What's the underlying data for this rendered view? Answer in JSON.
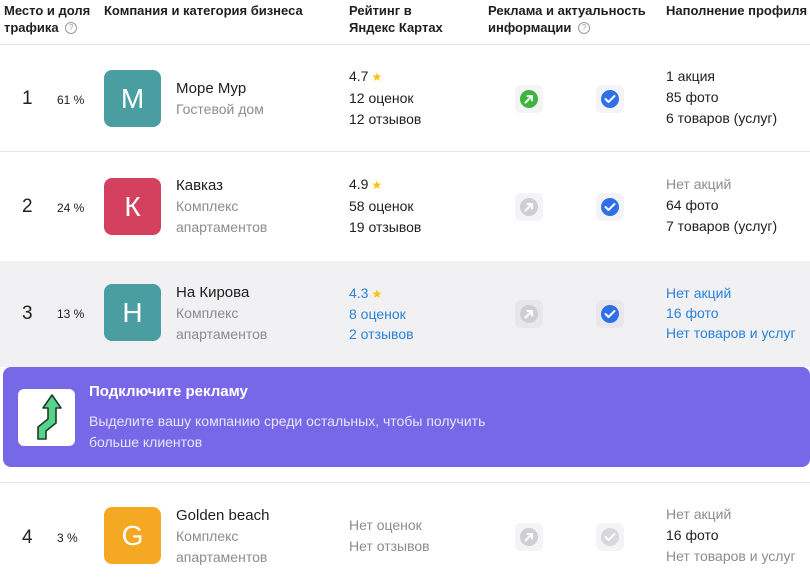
{
  "header": {
    "col_place": "Место и доля трафика",
    "col_company": "Компания и категория бизнеса",
    "col_rating": "Рейтинг в Яндекс Картах",
    "col_ads": "Реклама и актуальность информации",
    "col_profile": "Наполнение профиля",
    "help_glyph": "?"
  },
  "rows": [
    {
      "place": "1",
      "share": "61 %",
      "letter": "М",
      "avatar_color": "#4a9ea1",
      "name": "Море Мур",
      "category": "Гостевой дом",
      "rating": "4.7",
      "ratings_count": "12 оценок",
      "reviews_count": "12 отзывов",
      "ads_active": true,
      "info_verified": true,
      "promos": "1 акция",
      "photos": "85 фото",
      "goods": "6 товаров (услуг)"
    },
    {
      "place": "2",
      "share": "24 %",
      "letter": "К",
      "avatar_color": "#d4415f",
      "name": "Кавказ",
      "category": "Комплекс апартаментов",
      "rating": "4.9",
      "ratings_count": "58 оценок",
      "reviews_count": "19 отзывов",
      "ads_active": false,
      "info_verified": true,
      "promos": "Нет акций",
      "photos": "64 фото",
      "goods": "7 товаров (услуг)"
    },
    {
      "place": "3",
      "share": "13 %",
      "letter": "Н",
      "avatar_color": "#4a9ea1",
      "name": "На Кирова",
      "category": "Комплекс апартаментов",
      "rating": "4.3",
      "ratings_count": "8 оценок",
      "reviews_count": "2 отзывов",
      "ads_active": false,
      "info_verified": true,
      "promos": "Нет акций",
      "photos": "16 фото",
      "goods": "Нет товаров и услуг"
    },
    {
      "place": "4",
      "share": "3 %",
      "letter": "G",
      "avatar_color": "#f5a922",
      "name": "Golden beach",
      "category": "Комплекс апартаментов",
      "no_ratings": "Нет оценок",
      "no_reviews": "Нет отзывов",
      "ads_active": false,
      "info_verified": false,
      "promos": "Нет акций",
      "photos": "16 фото",
      "goods": "Нет товаров и услуг"
    }
  ],
  "promo": {
    "title": "Подключите рекламу",
    "text": "Выделите вашу компанию среди остальных, чтобы получить больше клиентов",
    "icon": "growth-arrow-icon"
  },
  "colors": {
    "accent_blue": "#2a81d8",
    "promo_bg": "#7768e8",
    "ads_green": "#3db43d",
    "verified_blue": "#2f6fe8",
    "star": "#f7c200"
  }
}
